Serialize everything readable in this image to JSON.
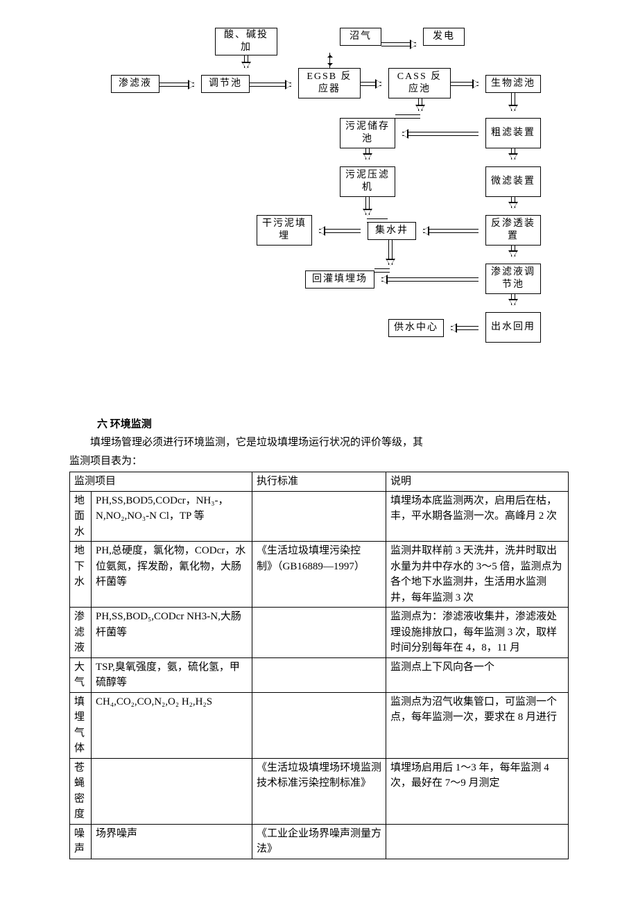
{
  "diagram": {
    "nodes": {
      "acid": "酸、碱投加",
      "leachate": "渗滤液",
      "tiaojie": "调节池",
      "egsb": "EGSB 反应器",
      "biogas": "沼气",
      "power": "发电",
      "cass": "CASS 反应池",
      "biofilter": "生物滤池",
      "sludgestore": "污泥储存池",
      "coarse": "粗滤装置",
      "sludgepress": "污泥压滤机",
      "microfilter": "微滤装置",
      "drysludge": "干污泥填埋",
      "sump": "集水井",
      "ro": "反渗透装置",
      "reinject": "回灌填埋场",
      "rotank": "渗滤液调节池",
      "supply": "供水中心",
      "reuse": "出水回用"
    }
  },
  "section": {
    "heading": "六 环境监测",
    "intro": "填埋场管理必须进行环境监测，它是垃圾填埋场运行状况的评价等级，其",
    "intro2": "监测项目表为："
  },
  "table": {
    "headers": {
      "item": "监测项目",
      "std": "执行标准",
      "note": "说明"
    },
    "rows": [
      {
        "label": "地面水",
        "param": "PH,SS,BOD5,CODcr，NH₃-，N,NO₂,NO₃-N Cl，TP 等",
        "std": "",
        "note": "填埋场本底监测两次，启用后在枯，丰，平水期各监测一次。高峰月 2 次"
      },
      {
        "label": "地下水",
        "param": "PH,总硬度，氯化物，CODcr，水位氨氮，挥发酚，氰化物，大肠杆菌等",
        "std": "《生活垃圾填埋污染控制》（GB16889—1997）",
        "note": "监测井取样前 3 天洗井，洗井时取出水量为井中存水的 3～5 倍，监测点为各个地下水监测井，生活用水监测井，每年监测 3 次"
      },
      {
        "label": "渗滤液",
        "param": "PH,SS,BOD₅,CODcr NH3-N,大肠杆菌等",
        "std": "",
        "note": "监测点为：渗滤液收集井，渗滤液处理设施排放口，每年监测 3 次，取样时间分别每年在 4，8，11 月"
      },
      {
        "label": "大气",
        "param": "TSP,臭氧强度，氨，硫化氢，甲硫醇等",
        "std": "",
        "note": "监测点上下风向各一个"
      },
      {
        "label": "填埋气体",
        "param": "CH₄,CO₂,CO,N₂,O₂ H₂,H₂S",
        "std": "",
        "note": "监测点为沼气收集管口，可监测一个点，每年监测一次，要求在 8 月进行"
      },
      {
        "label": "苍蝇密度",
        "param": "",
        "std": "《生活垃圾填埋场环境监测技术标准污染控制标准》",
        "note": "填埋场启用后 1～3 年，每年监测 4 次，最好在 7～9 月测定"
      },
      {
        "label": "噪声",
        "param": "场界噪声",
        "std": "《工业企业场界噪声测量方法》",
        "note": ""
      }
    ]
  }
}
